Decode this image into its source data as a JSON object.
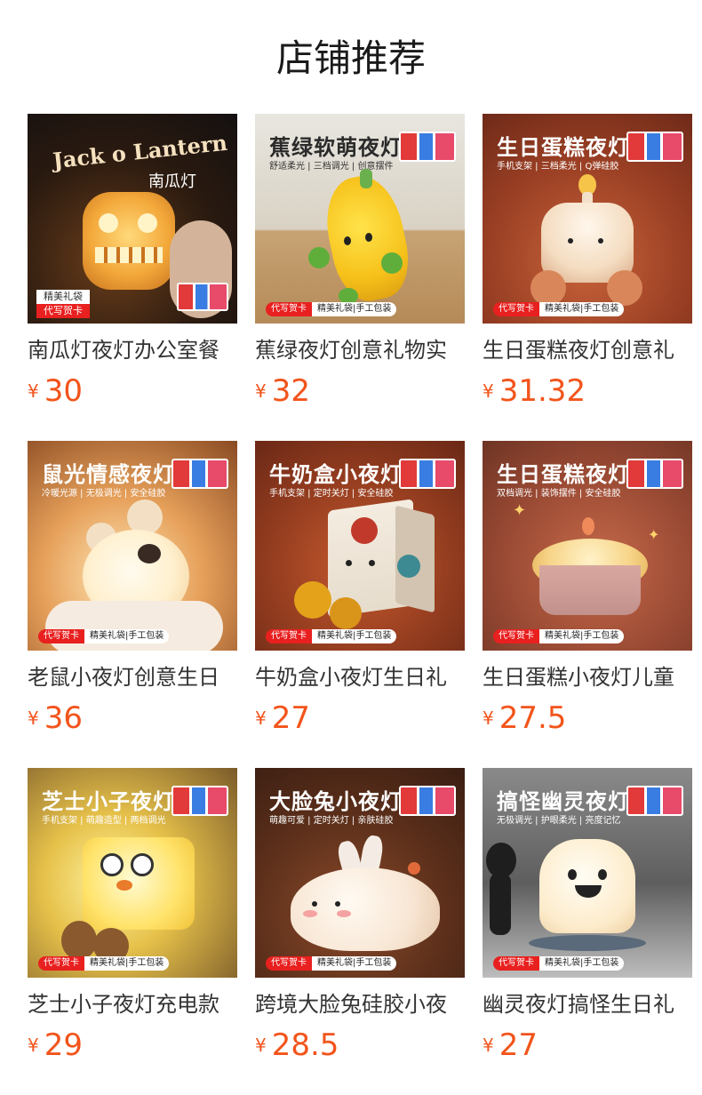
{
  "header": {
    "title": "店铺推荐"
  },
  "currency": "¥",
  "products": [
    {
      "name": "南瓜灯夜灯办公室餐",
      "price": "30",
      "image": {
        "banner": "Jack o Lantern",
        "subtitle": "南瓜灯",
        "tag1": "精美礼袋",
        "tag2": "代写贺卡",
        "theme": "pumpkin"
      }
    },
    {
      "name": "蕉绿夜灯创意礼物实",
      "price": "32",
      "image": {
        "banner": "蕉绿软萌夜灯",
        "subtitle": "舒适柔光 | 三档调光 | 创意摆件",
        "tag1": "代写贺卡",
        "tag2": "精美礼袋|手工包装",
        "theme": "banana"
      }
    },
    {
      "name": "生日蛋糕夜灯创意礼",
      "price": "31.32",
      "image": {
        "banner": "生日蛋糕夜灯",
        "subtitle": "手机支架 | 三档柔光 | Q弹硅胶",
        "tag1": "代写贺卡",
        "tag2": "精美礼袋|手工包装",
        "theme": "cake"
      }
    },
    {
      "name": "老鼠小夜灯创意生日",
      "price": "36",
      "image": {
        "banner": "鼠光情感夜灯",
        "subtitle": "冷暖光源 | 无极调光 | 安全硅胶",
        "tag1": "代写贺卡",
        "tag2": "精美礼袋|手工包装",
        "theme": "mouse"
      }
    },
    {
      "name": "牛奶盒小夜灯生日礼",
      "price": "27",
      "image": {
        "banner": "牛奶盒小夜灯",
        "subtitle": "手机支架 | 定时关灯 | 安全硅胶",
        "tag1": "代写贺卡",
        "tag2": "精美礼袋|手工包装",
        "theme": "milk"
      }
    },
    {
      "name": "生日蛋糕小夜灯儿童",
      "price": "27.5",
      "image": {
        "banner": "生日蛋糕夜灯",
        "subtitle": "双档调光 | 装饰摆件 | 安全硅胶",
        "tag1": "代写贺卡",
        "tag2": "精美礼袋|手工包装",
        "theme": "cake2"
      }
    },
    {
      "name": "芝士小子夜灯充电款",
      "price": "29",
      "image": {
        "banner": "芝士小子夜灯",
        "subtitle": "手机支架 | 萌趣造型 | 两档调光",
        "tag1": "代写贺卡",
        "tag2": "精美礼袋|手工包装",
        "theme": "cheese"
      }
    },
    {
      "name": "跨境大脸兔硅胶小夜",
      "price": "28.5",
      "image": {
        "banner": "大脸兔小夜灯",
        "subtitle": "萌趣可爱 | 定时关灯 | 亲肤硅胶",
        "tag1": "代写贺卡",
        "tag2": "精美礼袋|手工包装",
        "theme": "rabbit"
      }
    },
    {
      "name": "幽灵夜灯搞怪生日礼",
      "price": "27",
      "image": {
        "banner": "搞怪幽灵夜灯",
        "subtitle": "无极调光 | 护眼柔光 | 亮度记忆",
        "tag1": "代写贺卡",
        "tag2": "精美礼袋|手工包装",
        "theme": "ghost"
      }
    }
  ]
}
